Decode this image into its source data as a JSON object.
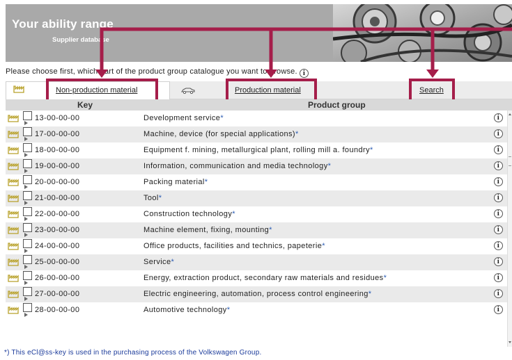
{
  "banner": {
    "title": "Your ability range",
    "subtitle": "Supplier database"
  },
  "intro": {
    "text": "Please choose first, which part of the product group catalogue you want to browse.",
    "info_icon": "info-icon"
  },
  "tabs": [
    {
      "label": "Non-production material",
      "icon": "factory-icon",
      "active": true
    },
    {
      "label": "Production material",
      "icon": "car-icon",
      "active": false
    },
    {
      "label": "Search",
      "icon": "",
      "active": false
    }
  ],
  "table": {
    "headers": {
      "key": "Key",
      "group": "Product group"
    },
    "rows": [
      {
        "key": "13-00-00-00",
        "group": "Development service",
        "marker": "*"
      },
      {
        "key": "17-00-00-00",
        "group": "Machine, device (for special applications)",
        "marker": "*"
      },
      {
        "key": "18-00-00-00",
        "group": "Equipment f. mining, metallurgical plant, rolling mill a. foundry",
        "marker": "*"
      },
      {
        "key": "19-00-00-00",
        "group": "Information, communication and media technology",
        "marker": "*"
      },
      {
        "key": "20-00-00-00",
        "group": "Packing material",
        "marker": "*"
      },
      {
        "key": "21-00-00-00",
        "group": "Tool",
        "marker": "*"
      },
      {
        "key": "22-00-00-00",
        "group": "Construction technology",
        "marker": "*"
      },
      {
        "key": "23-00-00-00",
        "group": "Machine element, fixing, mounting",
        "marker": "*"
      },
      {
        "key": "24-00-00-00",
        "group": "Office products, facilities and technics, papeterie",
        "marker": "*"
      },
      {
        "key": "25-00-00-00",
        "group": "Service",
        "marker": "*"
      },
      {
        "key": "26-00-00-00",
        "group": "Energy, extraction product, secondary raw materials and residues",
        "marker": "*"
      },
      {
        "key": "27-00-00-00",
        "group": "Electric engineering, automation, process control engineering",
        "marker": "*"
      },
      {
        "key": "28-00-00-00",
        "group": "Automotive technology",
        "marker": "*"
      }
    ]
  },
  "footnote": "*) This eCl@ss-key is used in the purchasing process of the Volkswagen Group.",
  "colors": {
    "highlight": "#a51e4a",
    "banner": "#a9a9a9",
    "row_alt": "#eaeaea",
    "factory_icon": "#b8a12a",
    "link_blue": "#2c5db3"
  }
}
